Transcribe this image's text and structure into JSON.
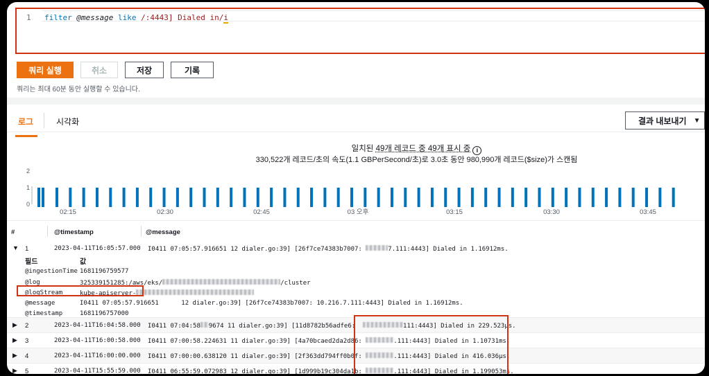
{
  "editor": {
    "line_number": "1",
    "code": {
      "cmd": "filter",
      "field": "@message",
      "op": "like",
      "pattern_start": "/:4443] Dialed in/",
      "flag": "i"
    }
  },
  "toolbar": {
    "run_label": "쿼리 실행",
    "cancel_label": "취소",
    "save_label": "저장",
    "history_label": "기록",
    "hint": "쿼리는 최대 60분 동안 실행할 수 있습니다."
  },
  "tabs": {
    "logs": "로그",
    "visualize": "시각화"
  },
  "export": {
    "label": "결과 내보내기"
  },
  "summary": {
    "line1_prefix": "일치된 ",
    "line1_count": "49개 레코드 중 49개 표시 중",
    "line2": "330,522개 레코드/초의 속도(1.1 GBPerSecond/초)로 3.0초 동안 980,990개 레코드($size)가 스캔됨"
  },
  "chart_data": {
    "type": "bar",
    "y_ticks": [
      "0",
      "1",
      "2"
    ],
    "ylim": [
      0,
      2
    ],
    "x_tick_labels": [
      "02:15",
      "02:30",
      "02:45",
      "03 오후",
      "03:15",
      "03:30",
      "03:45"
    ],
    "bar_color": "#0073bb",
    "note": "",
    "values_per_bin": [
      1,
      1,
      1,
      1,
      1,
      1,
      1,
      1,
      1,
      1,
      1,
      1,
      1,
      1,
      1,
      1,
      1,
      1,
      1,
      1,
      1,
      1,
      1,
      1,
      1,
      1,
      1,
      1,
      1,
      1,
      1,
      1,
      1,
      1,
      1,
      1,
      1,
      1,
      1,
      1,
      1,
      1,
      1,
      1,
      1,
      1,
      1,
      1,
      1
    ]
  },
  "table": {
    "headers": {
      "hash": "#",
      "timestamp": "@timestamp",
      "message": "@message"
    },
    "expanded_row": {
      "num": "1",
      "timestamp": "2023-04-11T16:05:57.000",
      "message": "I0411 07:05:57.916651 12 dialer.go:39] [26f7ce74383b7007:",
      "message_tail": "7.111:4443] Dialed in 1.16912ms."
    },
    "detail": {
      "field_header": "필드",
      "value_header": "값",
      "fields": [
        {
          "key": "@ingestionTime",
          "value": "1681196759577"
        },
        {
          "key": "@log",
          "value": "325339151285:/aws/eks/",
          "value_tail": "/cluster"
        },
        {
          "key": "@logStream",
          "value": "kube-apiserver-"
        },
        {
          "key": "@message",
          "value": "I0411 07:05:57.916651      12 dialer.go:39] [26f7ce74383b7007: 10.216.7.111:4443] Dialed in 1.16912ms."
        },
        {
          "key": "@timestamp",
          "value": "1681196757000"
        }
      ]
    },
    "rows": [
      {
        "num": "2",
        "timestamp": "2023-04-11T16:04:58.000",
        "message": "I0411 07:04:58",
        "mid": "9674 11 dialer.go:39] [11d8782b56adfe6:",
        "tail": "111:4443] Dialed in 229.523µs."
      },
      {
        "num": "3",
        "timestamp": "2023-04-11T16:00:58.000",
        "message": "I0411 07:00:58.224631 11 dialer.go:39] [4a70bcaed2da2d86:",
        "mid": "",
        "tail": ".111:4443] Dialed in 1.10731ms."
      },
      {
        "num": "4",
        "timestamp": "2023-04-11T16:00:00.000",
        "message": "I0411 07:00:00.638120 11 dialer.go:39] [2f363dd794ff0b0f:",
        "mid": "",
        "tail": ".111:4443] Dialed in 416.036µs."
      },
      {
        "num": "5",
        "timestamp": "2023-04-11T15:55:59.000",
        "message": "I0411 06:55:59.072983 12 dialer.go:39] [1d999b19c304da1b:",
        "mid": "",
        "tail": ".111:4443] Dialed in 1.199053ms."
      }
    ]
  }
}
